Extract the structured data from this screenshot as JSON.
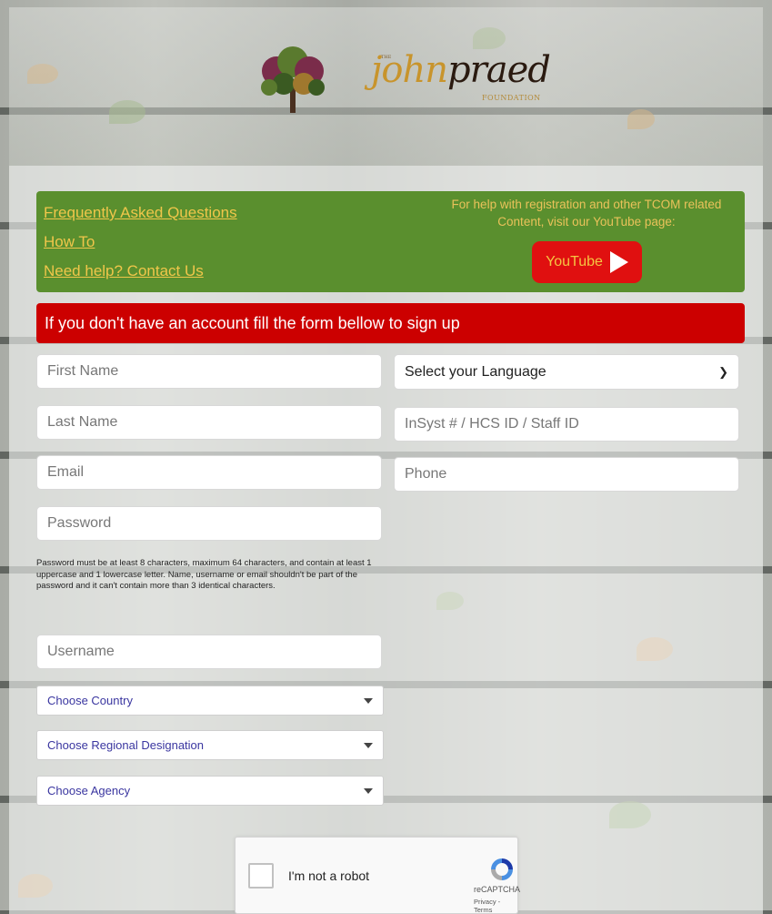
{
  "logo": {
    "the": "THE",
    "name_part1": "john",
    "name_part2": "praed",
    "foundation": "FOUNDATION"
  },
  "help": {
    "links": [
      "Frequently Asked Questions",
      "How To",
      "Need help? Contact Us"
    ],
    "youtube_text": "For help with registration and other TCOM related Content, visit our YouTube page:",
    "youtube_label": "YouTube"
  },
  "signup_banner": "If you don't have an account fill the form bellow to sign up",
  "form": {
    "first_name_placeholder": "First Name",
    "last_name_placeholder": "Last Name",
    "email_placeholder": "Email",
    "password_placeholder": "Password",
    "password_note": "Password must be at least 8 characters, maximum 64 characters, and contain at least 1 uppercase and 1 lowercase letter. Name, username or email shouldn't be part of the password and it can't contain more than 3 identical characters.",
    "username_placeholder": "Username",
    "language_selected": "Select your Language",
    "staff_id_placeholder": "InSyst # / HCS ID / Staff ID",
    "phone_placeholder": "Phone",
    "country_selected": "Choose Country",
    "region_selected": "Choose Regional Designation",
    "agency_selected": "Choose Agency"
  },
  "captcha": {
    "label": "I'm not a robot",
    "brand": "reCAPTCHA",
    "terms": "Privacy - Terms"
  },
  "colors": {
    "help_box": "#5a8f2e",
    "link": "#f0c64a",
    "banner": "#cc0000",
    "youtube": "#e01010",
    "dropdown_text": "#3a36a0"
  },
  "icons": [
    "tree-logo-icon",
    "youtube-play-icon",
    "chevron-down-icon",
    "caret-down-icon",
    "recaptcha-icon"
  ]
}
